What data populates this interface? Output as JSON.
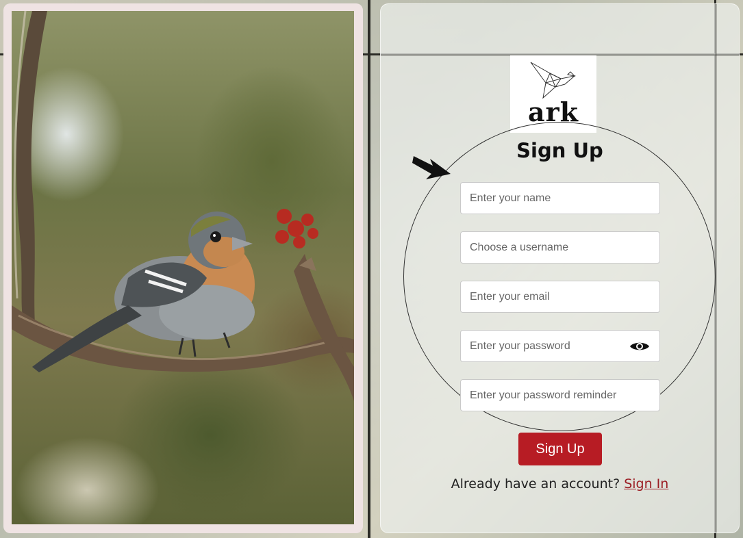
{
  "brand": {
    "logo_text": "ark"
  },
  "form": {
    "title": "Sign Up",
    "fields": {
      "name": {
        "placeholder": "Enter your name",
        "value": ""
      },
      "username": {
        "placeholder": "Choose a username",
        "value": ""
      },
      "email": {
        "placeholder": "Enter your email",
        "value": ""
      },
      "password": {
        "placeholder": "Enter your password",
        "value": "",
        "toggle_icon": "eye-icon"
      },
      "reminder": {
        "placeholder": "Enter your password reminder",
        "value": ""
      }
    },
    "submit_label": "Sign Up"
  },
  "footer": {
    "prompt": "Already have an account?",
    "link_label": "Sign In"
  },
  "colors": {
    "accent": "#b71c24",
    "link": "#9b1c22",
    "photo_frame": "#efe3e3"
  },
  "images": {
    "hero_photo": "bird-on-branch"
  }
}
